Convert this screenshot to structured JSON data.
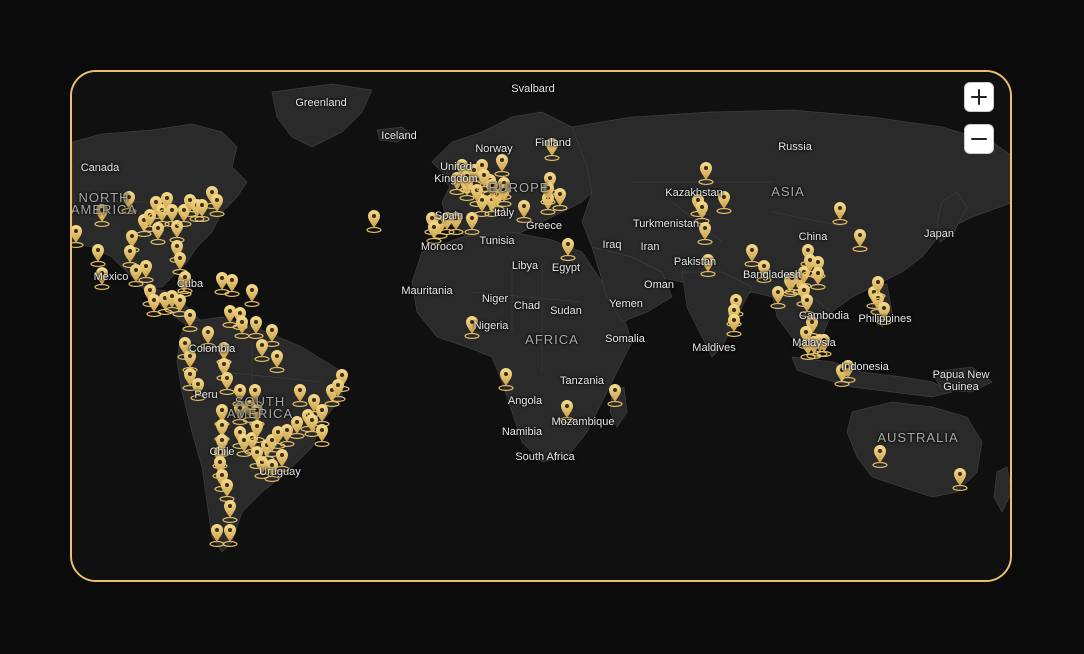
{
  "map": {
    "zoom_in_label": "+",
    "zoom_out_label": "−",
    "colors": {
      "pin": "#e9c46a",
      "land": "#2a2a2a",
      "water": "#101010",
      "border": "#e9c26a"
    },
    "labels": [
      {
        "id": "svalbard",
        "text": "Svalbard"
      },
      {
        "id": "greenland",
        "text": "Greenland"
      },
      {
        "id": "iceland",
        "text": "Iceland"
      },
      {
        "id": "norway",
        "text": "Norway"
      },
      {
        "id": "finland",
        "text": "Finland"
      },
      {
        "id": "russia",
        "text": "Russia"
      },
      {
        "id": "canada",
        "text": "Canada"
      },
      {
        "id": "north-america",
        "text": "NORTH AMERICA"
      },
      {
        "id": "united-kingdom",
        "text": "United Kingdom"
      },
      {
        "id": "europe",
        "text": "EUROPE"
      },
      {
        "id": "kazakhstan",
        "text": "Kazakhstan"
      },
      {
        "id": "asia",
        "text": "ASIA"
      },
      {
        "id": "spain",
        "text": "Spain"
      },
      {
        "id": "italy",
        "text": "Italy"
      },
      {
        "id": "greece",
        "text": "Greece"
      },
      {
        "id": "turkmenistan",
        "text": "Turkmenistan"
      },
      {
        "id": "china",
        "text": "China"
      },
      {
        "id": "japan",
        "text": "Japan"
      },
      {
        "id": "morocco",
        "text": "Morocco"
      },
      {
        "id": "tunisia",
        "text": "Tunisia"
      },
      {
        "id": "iraq",
        "text": "Iraq"
      },
      {
        "id": "iran",
        "text": "Iran"
      },
      {
        "id": "mexico",
        "text": "Mexico"
      },
      {
        "id": "libya",
        "text": "Libya"
      },
      {
        "id": "egypt",
        "text": "Egypt"
      },
      {
        "id": "pakistan",
        "text": "Pakistan"
      },
      {
        "id": "bangladesh",
        "text": "Bangladesh"
      },
      {
        "id": "cuba",
        "text": "Cuba"
      },
      {
        "id": "mauritania",
        "text": "Mauritania"
      },
      {
        "id": "niger",
        "text": "Niger"
      },
      {
        "id": "oman",
        "text": "Oman"
      },
      {
        "id": "chad",
        "text": "Chad"
      },
      {
        "id": "sudan",
        "text": "Sudan"
      },
      {
        "id": "yemen",
        "text": "Yemen"
      },
      {
        "id": "cambodia",
        "text": "Cambodia"
      },
      {
        "id": "philippines",
        "text": "Philippines"
      },
      {
        "id": "nigeria",
        "text": "Nigeria"
      },
      {
        "id": "colombia",
        "text": "Colombia"
      },
      {
        "id": "africa",
        "text": "AFRICA"
      },
      {
        "id": "somalia",
        "text": "Somalia"
      },
      {
        "id": "maldives",
        "text": "Maldives"
      },
      {
        "id": "malaysia",
        "text": "Malaysia"
      },
      {
        "id": "indonesia",
        "text": "Indonesia"
      },
      {
        "id": "tanzania",
        "text": "Tanzania"
      },
      {
        "id": "papua-new-guinea",
        "text": "Papua New Guinea"
      },
      {
        "id": "peru",
        "text": "Peru"
      },
      {
        "id": "south-america",
        "text": "SOUTH AMERICA"
      },
      {
        "id": "angola",
        "text": "Angola"
      },
      {
        "id": "mozambique",
        "text": "Mozambique"
      },
      {
        "id": "namibia",
        "text": "Namibia"
      },
      {
        "id": "australia",
        "text": "AUSTRALIA"
      },
      {
        "id": "south-africa",
        "text": "South Africa"
      },
      {
        "id": "chile",
        "text": "Chile"
      },
      {
        "id": "uruguay",
        "text": "Uruguay"
      }
    ]
  }
}
